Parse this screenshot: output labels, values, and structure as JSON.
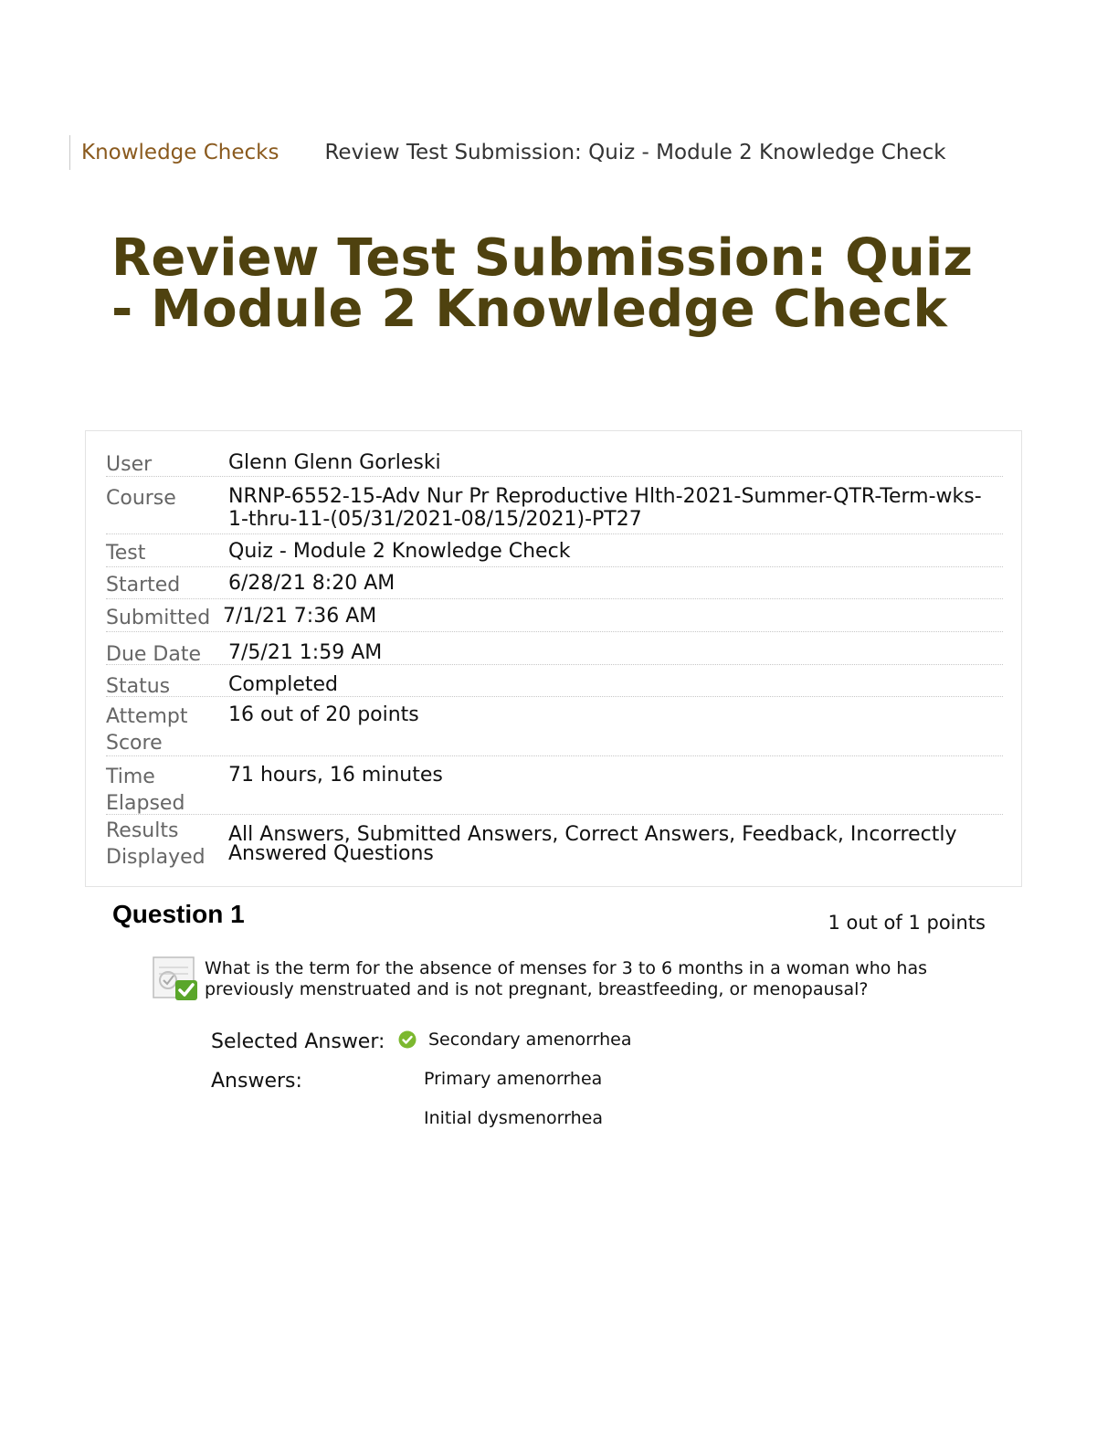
{
  "breadcrumb": {
    "parent": "Knowledge Checks",
    "current": "Review Test Submission: Quiz - Module 2 Knowledge Check"
  },
  "page_title": "Review Test Submission: Quiz - Module 2 Knowledge Check",
  "details": [
    {
      "label": "User",
      "value": "Glenn Glenn Gorleski"
    },
    {
      "label": "Course",
      "value": "NRNP-6552-15-Adv Nur Pr Reproductive Hlth-2021-Summer-QTR-Term-wks-1-thru-11-(05/31/2021-08/15/2021)-PT27"
    },
    {
      "label": "Test",
      "value": "Quiz - Module 2 Knowledge Check"
    },
    {
      "label": "Started",
      "value": "6/28/21 8:20 AM"
    },
    {
      "label": "Submitted",
      "value": "7/1/21 7:36 AM"
    },
    {
      "label": "Due Date",
      "value": "7/5/21 1:59 AM"
    },
    {
      "label": "Status",
      "value": "Completed"
    },
    {
      "label": "Attempt Score",
      "value": "16 out of 20 points"
    },
    {
      "label": "Time Elapsed",
      "value": "71 hours, 16 minutes"
    },
    {
      "label": "Results Displayed",
      "value": "All Answers, Submitted Answers, Correct Answers, Feedback, Incorrectly Answered Questions"
    }
  ],
  "question": {
    "title": "Question 1",
    "points": "1 out of 1 points",
    "text": "What is the term for the absence of menses for 3 to 6 months in a woman who has previously menstruated and is not pregnant, breastfeeding, or menopausal?",
    "selected_label": "Selected Answer:",
    "selected_answer": "Secondary amenorrhea",
    "answers_label": "Answers:",
    "answers": [
      "Primary amenorrhea",
      "Initial dysmenorrhea"
    ],
    "icon": "question-correct-icon",
    "check_icon": "check-circle-icon",
    "check_color": "#7cb82f"
  }
}
